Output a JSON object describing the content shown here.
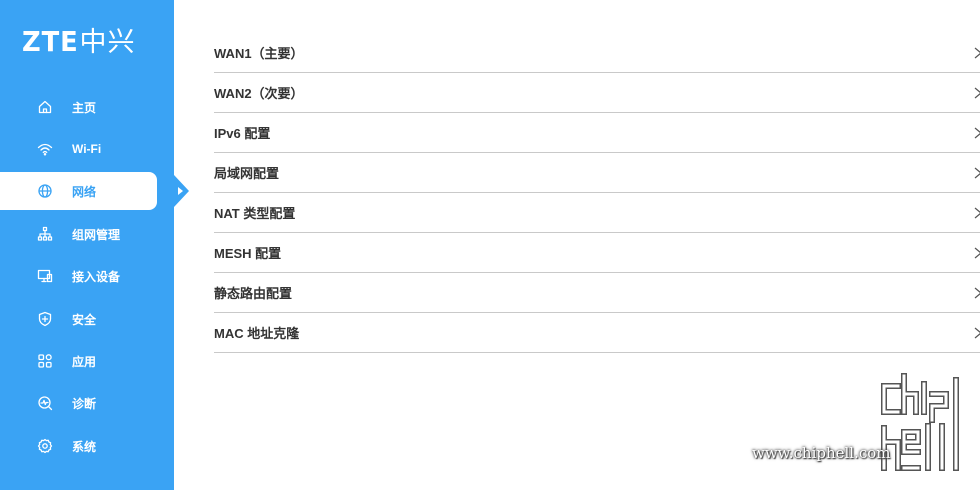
{
  "brand": {
    "logo_latin": "ZTE",
    "logo_cjk": "中兴"
  },
  "colors": {
    "sidebar_bg": "#3aa3f4",
    "text": "#333333",
    "divider": "#c9c9c9"
  },
  "sidebar": {
    "items": [
      {
        "label": "主页",
        "icon": "home-icon",
        "active": false
      },
      {
        "label": "Wi-Fi",
        "icon": "wifi-icon",
        "active": false
      },
      {
        "label": "网络",
        "icon": "globe-icon",
        "active": true
      },
      {
        "label": "组网管理",
        "icon": "network-topology-icon",
        "active": false
      },
      {
        "label": "接入设备",
        "icon": "devices-icon",
        "active": false
      },
      {
        "label": "安全",
        "icon": "shield-icon",
        "active": false
      },
      {
        "label": "应用",
        "icon": "apps-grid-icon",
        "active": false
      },
      {
        "label": "诊断",
        "icon": "diagnosis-icon",
        "active": false
      },
      {
        "label": "系统",
        "icon": "gear-icon",
        "active": false
      }
    ]
  },
  "main": {
    "menu": [
      {
        "label": "WAN1（主要）"
      },
      {
        "label": "WAN2（次要）"
      },
      {
        "label": "IPv6 配置"
      },
      {
        "label": "局域网配置"
      },
      {
        "label": "NAT 类型配置"
      },
      {
        "label": "MESH 配置"
      },
      {
        "label": "静态路由配置"
      },
      {
        "label": "MAC 地址克隆"
      }
    ]
  },
  "watermark": {
    "url": "www.chiphell.com",
    "logo_text": "chiphell"
  }
}
